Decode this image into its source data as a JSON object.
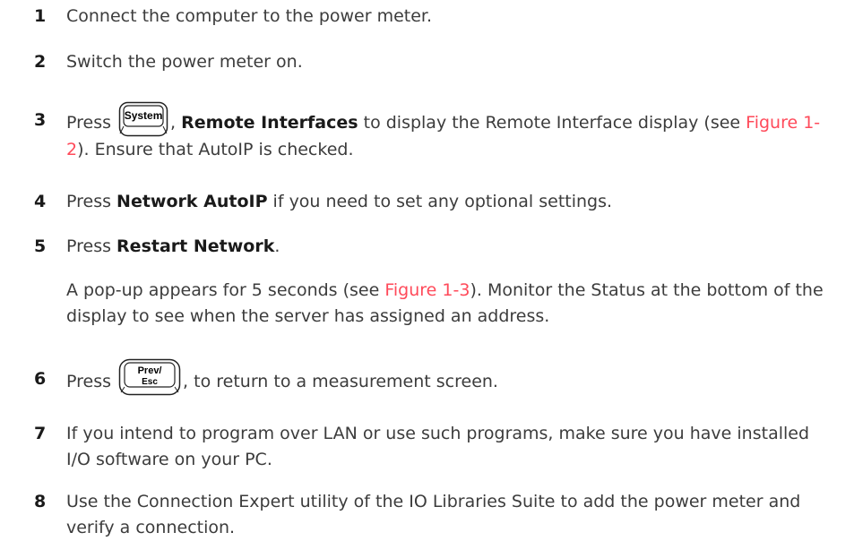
{
  "steps": [
    {
      "num": "1",
      "text": "Connect the computer to the power meter."
    },
    {
      "num": "2",
      "text": "Switch the power meter on."
    },
    {
      "num": "3",
      "pre": "Press ",
      "key": "System",
      "mid": ", ",
      "bold": "Remote Interfaces",
      "post": " to display the Remote Interface display (see ",
      "link": "Figure 1-2",
      "post2": "). Ensure that AutoIP is checked."
    },
    {
      "num": "4",
      "pre": "Press ",
      "bold": "Network AutoIP",
      "post": " if you need to set any optional settings."
    },
    {
      "num": "5",
      "pre": "Press ",
      "bold": "Restart Network",
      "post": "."
    },
    {
      "num": "6",
      "pre": "Press ",
      "key_line1": "Prev/",
      "key_line2": "Esc",
      "post": ", to return to a measurement screen."
    },
    {
      "num": "7",
      "text": "If you intend to program over LAN or use such programs, make sure you have installed I/O software on your PC."
    },
    {
      "num": "8",
      "text": "Use the Connection Expert utility of the IO Libraries Suite to add the power meter and verify a connection."
    }
  ],
  "popup_note": {
    "pre": "A pop-up appears for 5 seconds (see ",
    "link": "Figure 1-3",
    "post": "). Monitor the Status at the bottom of the display to see when the server has assigned an address."
  },
  "colors": {
    "link": "#ff4a5a",
    "text": "#3c3c3c"
  }
}
